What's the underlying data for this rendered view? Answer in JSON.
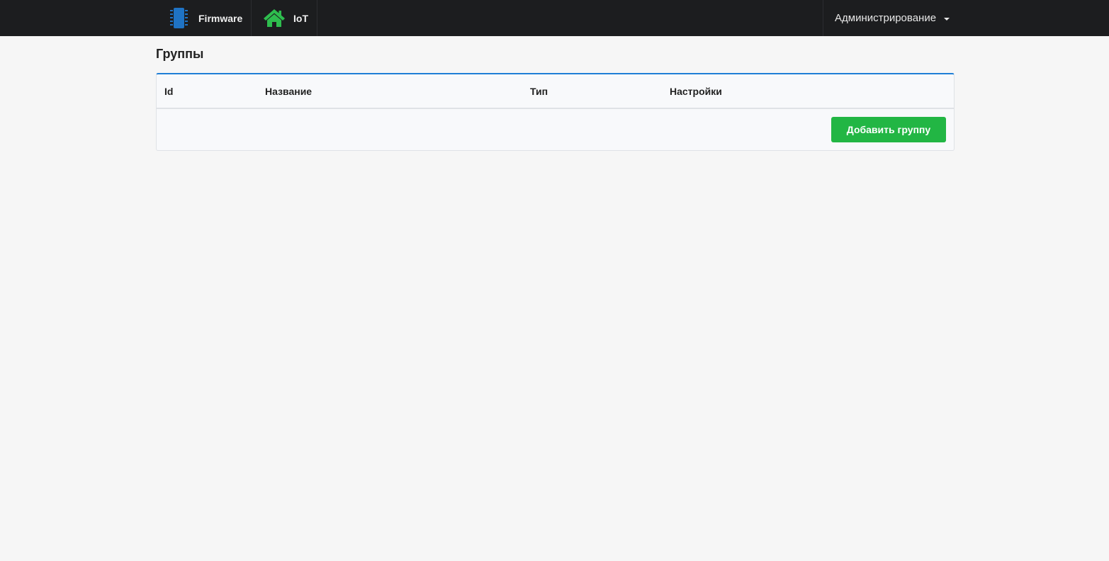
{
  "navbar": {
    "firmware": {
      "label": "Firmware",
      "icon": "chip-icon",
      "icon_color": "#1f73c4"
    },
    "iot": {
      "label": "IoT",
      "icon": "home-icon",
      "icon_color": "#2ebd4e"
    },
    "admin": {
      "label": "Администрирование",
      "icon": "caret-down-icon"
    }
  },
  "page": {
    "title": "Группы"
  },
  "table": {
    "columns": [
      "Id",
      "Название",
      "Тип",
      "Настройки"
    ],
    "rows": []
  },
  "actions": {
    "add_group_label": "Добавить группу"
  },
  "colors": {
    "navbar_bg": "#1c1d1f",
    "accent": "#1f7fd6",
    "add_button": "#22b644"
  }
}
